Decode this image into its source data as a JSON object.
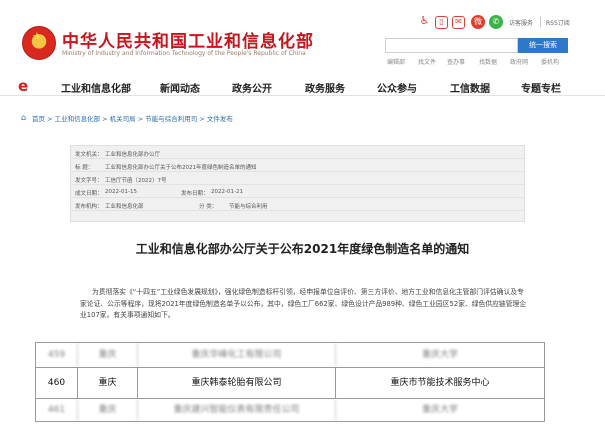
{
  "header": {
    "title": "中华人民共和国工业和信息化部",
    "subtitle": "Ministry of Industry and Information Technology of the People's Republic of China",
    "top_links": [
      "访客服务",
      "RSS订阅"
    ],
    "icons": [
      "accessibility-icon",
      "mobile-icon",
      "mail-icon",
      "weibo-icon",
      "wechat-icon"
    ],
    "search_placeholder": "",
    "search_button": "统一搜索",
    "quick_links": [
      "编辑部",
      "找文件",
      "查办事",
      "找数据",
      "政府网",
      "委机构"
    ]
  },
  "nav": {
    "logo": "e",
    "items": [
      "工业和信息化部",
      "新闻动态",
      "政务公开",
      "政务服务",
      "公众参与",
      "工信数据",
      "专题专栏"
    ]
  },
  "breadcrumb": {
    "text": "首页 > 工业和信息化部 > 机关司局 > 节能与综合利用司 > 文件发布"
  },
  "meta": {
    "issuer_label": "发文机关：",
    "issuer": "工业和信息化部办公厅",
    "title_label": "标    题：",
    "title": "工业和信息化部办公厅关于公布2021年度绿色制造名单的通知",
    "doc_no_label": "发文字号：",
    "doc_no": "工信厅节函〔2022〕7号",
    "date_label": "成文日期：",
    "date": "2022-01-15",
    "publish_label": "发布日期：",
    "publish": "2022-01-21",
    "org_label": "发布机构：",
    "org": "工业和信息化部",
    "category_label": "分    类：",
    "category": "节能与综合利用"
  },
  "document": {
    "title": "工业和信息化部办公厅关于公布2021年度绿色制造名单的通知",
    "paragraph": "为贯彻落实《“十四五”工业绿色发展规划》，强化绿色制造标杆引领，经申报单位自评价、第三方评价、地方工业和信息化主管部门评估确认及专家论证、公示等程序，现将2021年度绿色制造名单予以公布，其中，绿色工厂662家、绿色设计产品989种、绿色工业园区52家、绿色供应链管理企业107家。有关事项通知如下。"
  },
  "table": {
    "rows": [
      {
        "no": "459",
        "region": "重庆",
        "company": "重庆华峰化工有限公司",
        "evaluator": "重庆大学"
      },
      {
        "no": "460",
        "region": "重庆",
        "company": "重庆韩泰轮胎有限公司",
        "evaluator": "重庆市节能技术服务中心"
      },
      {
        "no": "461",
        "region": "重庆",
        "company": "重庆建兴智能仪表有限责任公司",
        "evaluator": "重庆大学"
      }
    ]
  }
}
